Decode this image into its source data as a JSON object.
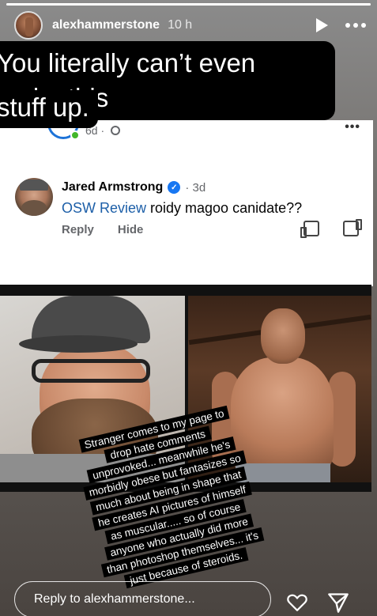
{
  "header": {
    "username": "alexhammerstone",
    "time_ago": "10 h",
    "progress_fraction": 1.0
  },
  "overlay": {
    "top_text_line1": "You literally can’t even make this",
    "top_text_line2": "stuff up.",
    "rotated_text_lines": [
      "Stranger comes to my page to",
      "drop hate comments",
      "unprovoked... meanwhile he's",
      "morbidly obese but fantasizes so",
      "much about being in shape that",
      "he creates AI pictures of himself",
      "as muscular..... so of course",
      "anyone who actually did more",
      "than photoshop themselves... it's",
      "just because of steroids."
    ]
  },
  "screenshot": {
    "post_time": "6d ·",
    "comment": {
      "author": "Jared Armstrong",
      "time": "· 3d",
      "mention": "OSW Review",
      "text": " roidy magoo canidate??",
      "reply_label": "Reply",
      "hide_label": "Hide"
    }
  },
  "footer": {
    "reply_placeholder": "Reply to alexhammerstone..."
  },
  "colors": {
    "facebook_blue": "#1877f2",
    "mention_blue": "#1d5fa8",
    "online_green": "#42b72a"
  }
}
